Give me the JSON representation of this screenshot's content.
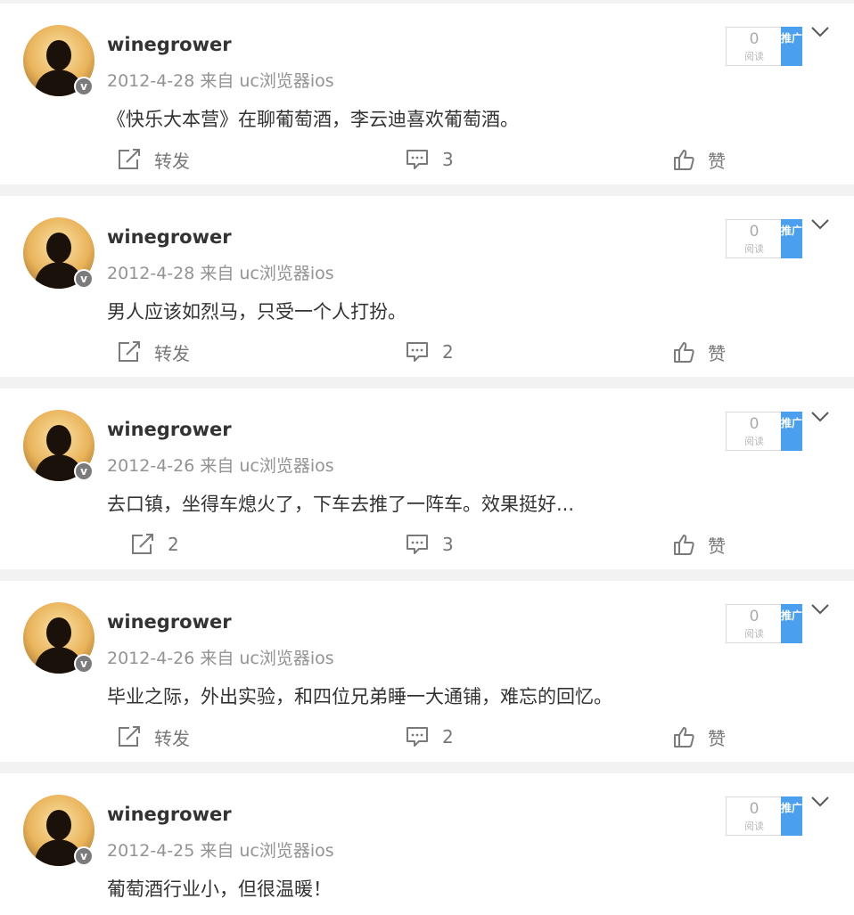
{
  "colors": {
    "page_bg": "#f2f2f2",
    "card_bg": "#ffffff",
    "username": "#333333",
    "meta": "#939393",
    "promote_badge": "#4a9fef",
    "icon": "#7a7a7a"
  },
  "icons": {
    "forward": "share-box-icon",
    "comment": "comment-bubble-icon",
    "like": "thumbs-up-icon",
    "menu": "chevron-down-icon",
    "verified": "verified-v-badge"
  },
  "posts": [
    {
      "username": "winegrower",
      "date": "2012-4-28",
      "source": "来自 uc浏览器ios",
      "verified_badge": "v",
      "text": "《快乐大本营》在聊葡萄酒，李云迪喜欢葡萄酒。",
      "read_count": "0",
      "read_label": "阅读",
      "promote_label": "推广",
      "forward": "转发",
      "comments": "3",
      "like": "赞"
    },
    {
      "username": "winegrower",
      "date": "2012-4-28",
      "source": "来自 uc浏览器ios",
      "verified_badge": "v",
      "text": "男人应该如烈马，只受一个人打扮。",
      "read_count": "0",
      "read_label": "阅读",
      "promote_label": "推广",
      "forward": "转发",
      "comments": "2",
      "like": "赞"
    },
    {
      "username": "winegrower",
      "date": "2012-4-26",
      "source": "来自 uc浏览器ios",
      "verified_badge": "v",
      "text": "去口镇，坐得车熄火了，下车去推了一阵车。效果挺好...",
      "read_count": "0",
      "read_label": "阅读",
      "promote_label": "推广",
      "forward": "2",
      "comments": "3",
      "like": "赞"
    },
    {
      "username": "winegrower",
      "date": "2012-4-26",
      "source": "来自 uc浏览器ios",
      "verified_badge": "v",
      "text": "毕业之际，外出实验，和四位兄弟睡一大通铺，难忘的回忆。",
      "read_count": "0",
      "read_label": "阅读",
      "promote_label": "推广",
      "forward": "转发",
      "comments": "2",
      "like": "赞"
    },
    {
      "username": "winegrower",
      "date": "2012-4-25",
      "source": "来自 uc浏览器ios",
      "verified_badge": "v",
      "text": "葡萄酒行业小，但很温暖！",
      "read_count": "0",
      "read_label": "阅读",
      "promote_label": "推广"
    }
  ]
}
